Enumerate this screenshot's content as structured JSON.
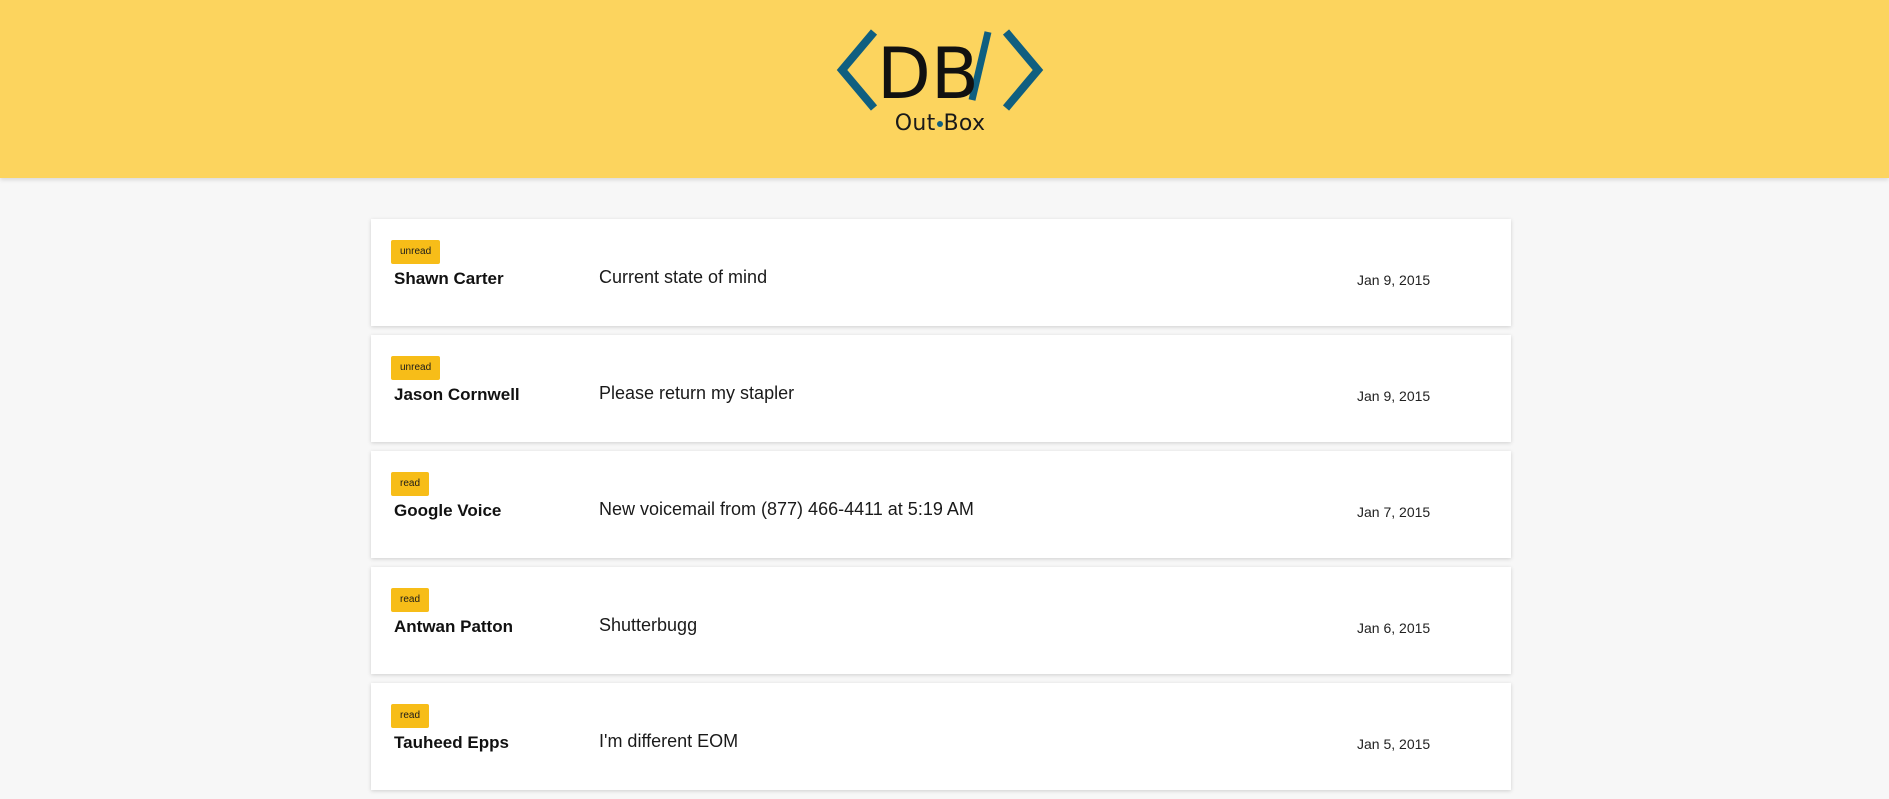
{
  "header": {
    "background": "#fcd45e",
    "logo": {
      "mark_text": "DB",
      "name_part1": "Out",
      "name_part2": "Box",
      "accent_color": "#0f5f80",
      "icon": "code-brackets-icon"
    }
  },
  "messages": [
    {
      "status": "unread",
      "sender": "Shawn Carter",
      "subject": "Current state of mind",
      "date": "Jan 9, 2015"
    },
    {
      "status": "unread",
      "sender": "Jason Cornwell",
      "subject": "Please return my stapler",
      "date": "Jan 9, 2015"
    },
    {
      "status": "read",
      "sender": "Google Voice",
      "subject": "New voicemail from (877) 466-4411 at 5:19 AM",
      "date": "Jan 7, 2015"
    },
    {
      "status": "read",
      "sender": "Antwan Patton",
      "subject": "Shutterbugg",
      "date": "Jan 6, 2015"
    },
    {
      "status": "read",
      "sender": "Tauheed Epps",
      "subject": "I'm different EOM",
      "date": "Jan 5, 2015"
    }
  ],
  "colors": {
    "badge": "#f7bd18",
    "page_background": "#f7f7f7"
  }
}
